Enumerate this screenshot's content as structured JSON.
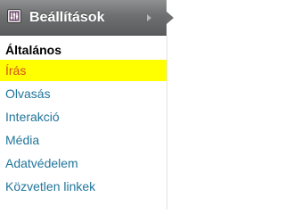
{
  "header": {
    "title": "Beállítások",
    "icon": "settings-icon",
    "expand_icon": "chevron-right-icon",
    "colors": {
      "bar": "#6e6f70",
      "label": "#ffffff"
    }
  },
  "submenu": {
    "heading": "Általános",
    "items": [
      {
        "label": "Írás",
        "state": "current"
      },
      {
        "label": "Olvasás"
      },
      {
        "label": "Interakció"
      },
      {
        "label": "Média"
      },
      {
        "label": "Adatvédelem"
      },
      {
        "label": "Közvetlen linkek"
      }
    ],
    "colors": {
      "link": "#21759b",
      "current_text": "#d54e21",
      "current_bg": "#ffff00"
    }
  }
}
